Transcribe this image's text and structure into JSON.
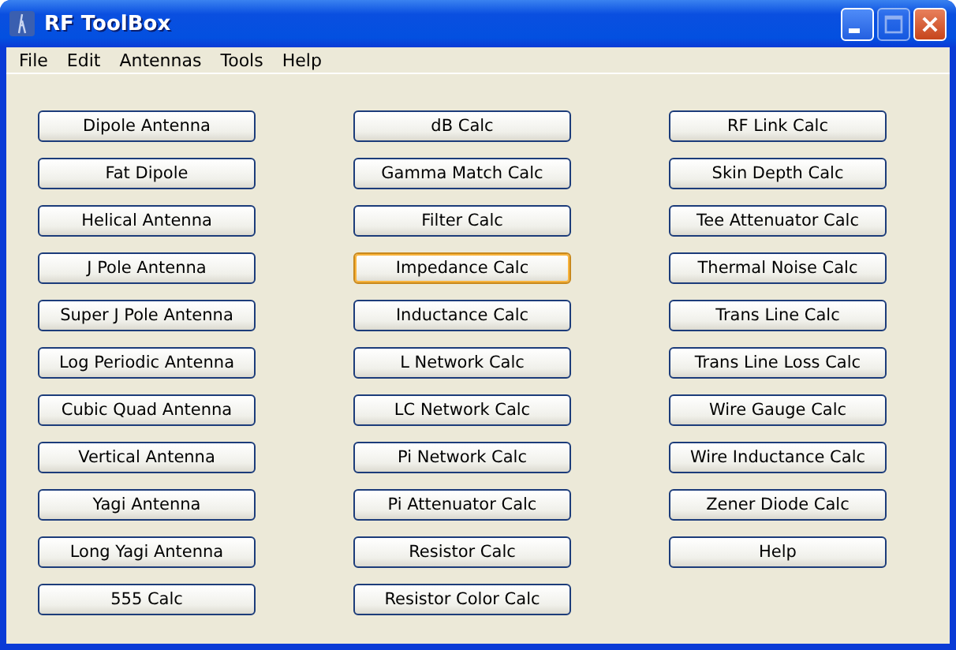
{
  "window": {
    "title": "RF ToolBox",
    "maximize_disabled": true
  },
  "menu": [
    "File",
    "Edit",
    "Antennas",
    "Tools",
    "Help"
  ],
  "columns": [
    [
      {
        "label": "Dipole Antenna",
        "hovered": false
      },
      {
        "label": "Fat Dipole",
        "hovered": false
      },
      {
        "label": "Helical Antenna",
        "hovered": false
      },
      {
        "label": "J Pole Antenna",
        "hovered": false
      },
      {
        "label": "Super J Pole Antenna",
        "hovered": false
      },
      {
        "label": "Log Periodic Antenna",
        "hovered": false
      },
      {
        "label": "Cubic Quad Antenna",
        "hovered": false
      },
      {
        "label": "Vertical Antenna",
        "hovered": false
      },
      {
        "label": "Yagi Antenna",
        "hovered": false
      },
      {
        "label": "Long Yagi Antenna",
        "hovered": false
      },
      {
        "label": "555 Calc",
        "hovered": false
      }
    ],
    [
      {
        "label": "dB Calc",
        "hovered": false
      },
      {
        "label": "Gamma Match Calc",
        "hovered": false
      },
      {
        "label": "Filter Calc",
        "hovered": false
      },
      {
        "label": "Impedance Calc",
        "hovered": true
      },
      {
        "label": "Inductance Calc",
        "hovered": false
      },
      {
        "label": "L Network Calc",
        "hovered": false
      },
      {
        "label": "LC Network Calc",
        "hovered": false
      },
      {
        "label": "Pi Network Calc",
        "hovered": false
      },
      {
        "label": "Pi Attenuator Calc",
        "hovered": false
      },
      {
        "label": "Resistor Calc",
        "hovered": false
      },
      {
        "label": "Resistor Color Calc",
        "hovered": false
      }
    ],
    [
      {
        "label": "RF Link Calc",
        "hovered": false
      },
      {
        "label": "Skin Depth Calc",
        "hovered": false
      },
      {
        "label": "Tee Attenuator Calc",
        "hovered": false
      },
      {
        "label": "Thermal Noise Calc",
        "hovered": false
      },
      {
        "label": "Trans Line Calc",
        "hovered": false
      },
      {
        "label": "Trans Line Loss Calc",
        "hovered": false
      },
      {
        "label": "Wire Gauge Calc",
        "hovered": false
      },
      {
        "label": "Wire Inductance Calc",
        "hovered": false
      },
      {
        "label": "Zener Diode Calc",
        "hovered": false
      },
      {
        "label": "Help",
        "hovered": false
      }
    ]
  ]
}
